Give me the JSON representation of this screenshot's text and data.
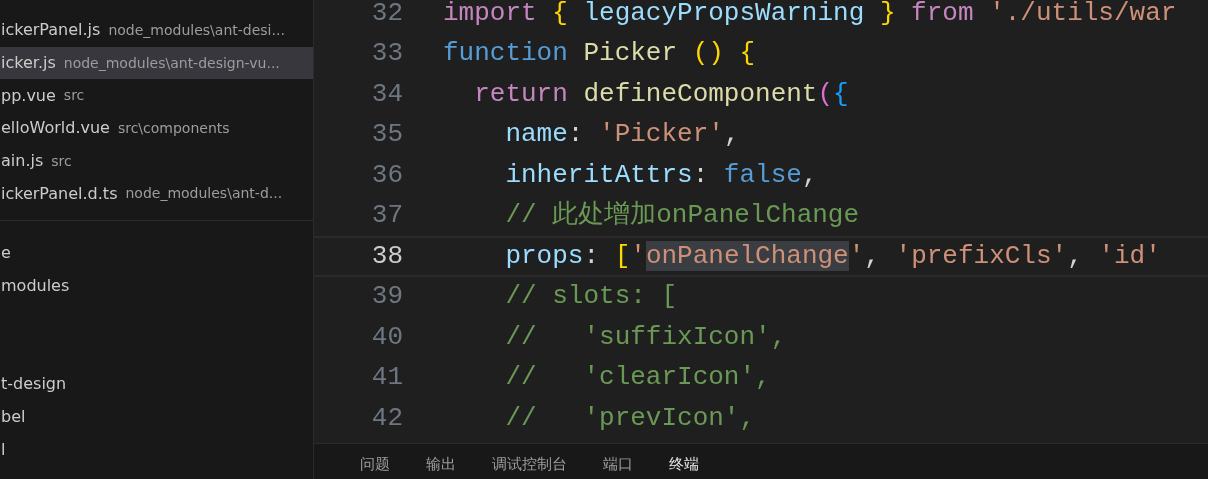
{
  "open_editors": [
    {
      "name": "ickerPanel.js",
      "path": "node_modules\\ant-desi...",
      "selected": false
    },
    {
      "name": "icker.js",
      "path": "node_modules\\ant-design-vu...",
      "selected": true
    },
    {
      "name": "pp.vue",
      "path": "src",
      "selected": false
    },
    {
      "name": "elloWorld.vue",
      "path": "src\\components",
      "selected": false
    },
    {
      "name": "ain.js",
      "path": "src",
      "selected": false
    },
    {
      "name": "ickerPanel.d.ts",
      "path": "node_modules\\ant-d...",
      "selected": false
    }
  ],
  "explorer_tree": [
    "e",
    "modules",
    "t-design",
    "bel",
    "l"
  ],
  "editor": {
    "lines": [
      {
        "number": "32",
        "current": false,
        "tokens": [
          {
            "text": "import ",
            "kind": "keyword"
          },
          {
            "text": "{",
            "kind": "bracket1"
          },
          {
            "text": " legacyPropsWarning ",
            "kind": "variable"
          },
          {
            "text": "} ",
            "kind": "bracket1"
          },
          {
            "text": "from ",
            "kind": "keyword"
          },
          {
            "text": "'./utils/war",
            "kind": "string"
          }
        ]
      },
      {
        "number": "33",
        "current": false,
        "tokens": [
          {
            "text": "function ",
            "kind": "storage"
          },
          {
            "text": "Picker ",
            "kind": "function"
          },
          {
            "text": "() {",
            "kind": "bracket1"
          }
        ]
      },
      {
        "number": "34",
        "current": false,
        "tokens": [
          {
            "text": "  return ",
            "kind": "keyword"
          },
          {
            "text": "defineComponent",
            "kind": "function"
          },
          {
            "text": "(",
            "kind": "bracket2"
          },
          {
            "text": "{",
            "kind": "bracket3"
          }
        ]
      },
      {
        "number": "35",
        "current": false,
        "tokens": [
          {
            "text": "    name",
            "kind": "variable"
          },
          {
            "text": ": ",
            "kind": "plain"
          },
          {
            "text": "'Picker'",
            "kind": "string"
          },
          {
            "text": ",",
            "kind": "plain"
          }
        ]
      },
      {
        "number": "36",
        "current": false,
        "tokens": [
          {
            "text": "    inheritAttrs",
            "kind": "variable"
          },
          {
            "text": ": ",
            "kind": "plain"
          },
          {
            "text": "false",
            "kind": "storage"
          },
          {
            "text": ",",
            "kind": "plain"
          }
        ]
      },
      {
        "number": "37",
        "current": false,
        "tokens": [
          {
            "text": "    // 此处增加onPanelChange",
            "kind": "comment"
          }
        ]
      },
      {
        "number": "38",
        "current": true,
        "tokens": [
          {
            "text": "    props",
            "kind": "variable"
          },
          {
            "text": ": ",
            "kind": "plain"
          },
          {
            "text": "[",
            "kind": "bracket1"
          },
          {
            "text": "'",
            "kind": "string"
          },
          {
            "text": "onPanelChange",
            "kind": "string",
            "highlighted": true
          },
          {
            "text": "'",
            "kind": "string"
          },
          {
            "text": ", ",
            "kind": "plain"
          },
          {
            "text": "'prefixCls'",
            "kind": "string"
          },
          {
            "text": ", ",
            "kind": "plain"
          },
          {
            "text": "'id'",
            "kind": "string"
          }
        ]
      },
      {
        "number": "39",
        "current": false,
        "tokens": [
          {
            "text": "    // slots: [",
            "kind": "comment"
          }
        ]
      },
      {
        "number": "40",
        "current": false,
        "tokens": [
          {
            "text": "    //   'suffixIcon',",
            "kind": "comment"
          }
        ]
      },
      {
        "number": "41",
        "current": false,
        "tokens": [
          {
            "text": "    //   'clearIcon',",
            "kind": "comment"
          }
        ]
      },
      {
        "number": "42",
        "current": false,
        "tokens": [
          {
            "text": "    //   'prevIcon',",
            "kind": "comment"
          }
        ]
      }
    ]
  },
  "panel_tabs": [
    {
      "label": "问题",
      "selected": false
    },
    {
      "label": "输出",
      "selected": false
    },
    {
      "label": "调试控制台",
      "selected": false
    },
    {
      "label": "端口",
      "selected": false
    },
    {
      "label": "终端",
      "selected": true
    }
  ]
}
